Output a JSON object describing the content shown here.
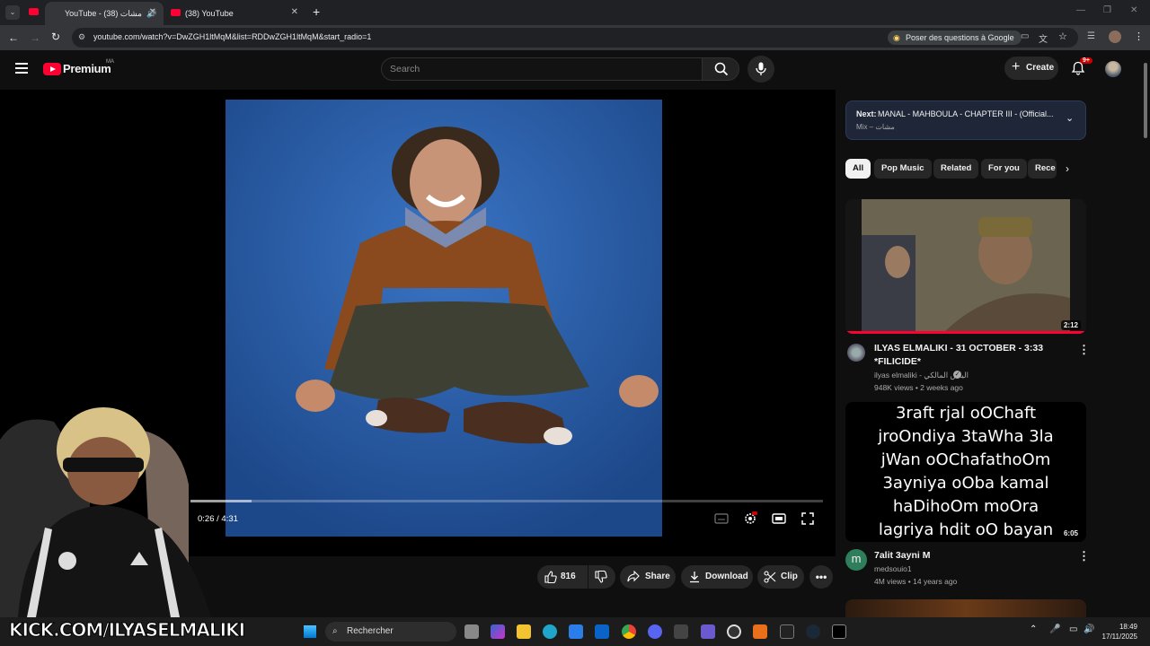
{
  "browser": {
    "tabs": [
      {
        "title": "YouTube - مشات (38)",
        "active": true
      },
      {
        "title": "(38) YouTube",
        "active": false
      }
    ],
    "url": "youtube.com/watch?v=DwZGH1ltMqM&list=RDDwZGH1ltMqM&start_radio=1",
    "gemini_label": "Poser des questions à Google"
  },
  "header": {
    "logo_text": "Premium",
    "logo_badge": "MA",
    "search_placeholder": "Search",
    "create_label": "Create",
    "notif_count": "9+"
  },
  "player": {
    "time": "0:26 / 4:31",
    "progress_fraction": 0.096
  },
  "actions": {
    "like_count": "816",
    "share_label": "Share",
    "download_label": "Download",
    "clip_label": "Clip"
  },
  "sidebar": {
    "next_prefix": "Next:",
    "next_title": "MANAL - MAHBOULA - CHAPTER III - (Official...",
    "next_sub": "Mix – مشات",
    "chips": [
      "All",
      "Pop Music",
      "Related",
      "For you",
      "Rece"
    ],
    "videos": [
      {
        "title_line1": "ILYAS ELMALIKI - 31 OCTOBER - 3:33",
        "title_line2": "*FILICIDE*",
        "channel": "ilyas elmaliki - الياس المالكي",
        "meta": "948K views • 2 weeks ago",
        "duration": "2:12"
      },
      {
        "thumb_text": [
          "3raft rjal oOChaft",
          "jroOndiya 3taWha 3la",
          "jWan oOChafathoOm",
          "3ayniya oOba kamal",
          "haDihoOm moOra",
          "lagriya hdit oO bayan"
        ],
        "title": "7alit 3ayni M",
        "channel": "medsouio1",
        "meta": "4M views • 14 years ago",
        "duration": "6:05",
        "avatar_letter": "m"
      }
    ]
  },
  "overlay": {
    "kick_text": "KICK.COM/ILYASELMALIKI"
  },
  "taskbar": {
    "search_label": "Rechercher",
    "time": "18:49",
    "date": "17/11/2025"
  }
}
